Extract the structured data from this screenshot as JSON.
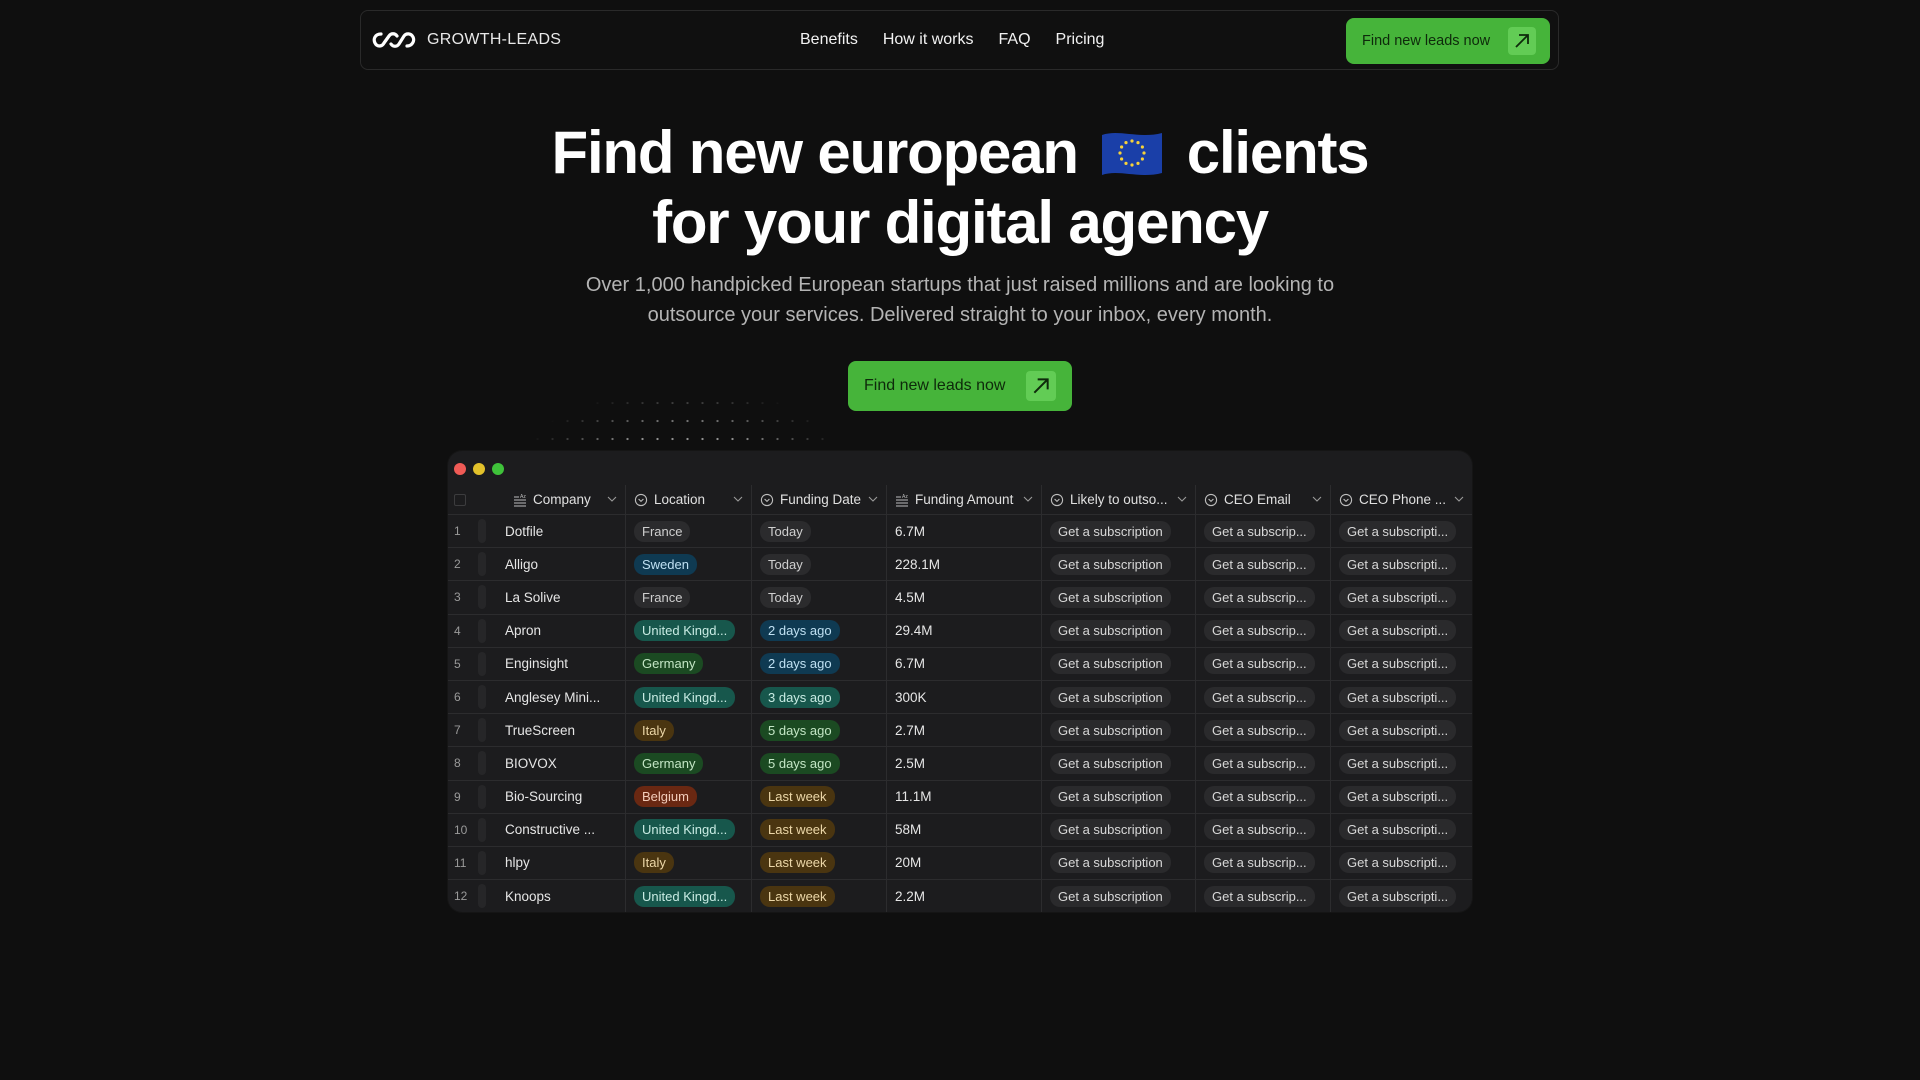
{
  "nav": {
    "brand": "GROWTH-LEADS",
    "links": [
      "Benefits",
      "How it works",
      "FAQ",
      "Pricing"
    ],
    "cta_label": "Find new leads now"
  },
  "hero": {
    "title_line1_before": "Find new european",
    "title_flag": "eu-flag",
    "title_line1_after": "clients",
    "title_line2": "for your digital agency",
    "subtitle_line1": "Over 1,000 handpicked European startups that just raised millions and are looking to",
    "subtitle_line2": "outsource your services. Delivered straight to your inbox, every month.",
    "cta_label": "Find new leads now"
  },
  "colors": {
    "accent": "#46b43a",
    "background": "#0f0f0f",
    "table_bg": "#1c1c1e"
  },
  "table": {
    "columns": [
      {
        "label": "Company",
        "icon": "text-icon"
      },
      {
        "label": "Location",
        "icon": "select-icon"
      },
      {
        "label": "Funding Date",
        "icon": "select-icon"
      },
      {
        "label": "Funding Amount",
        "icon": "text-icon"
      },
      {
        "label": "Likely to outso...",
        "icon": "select-icon"
      },
      {
        "label": "CEO Email",
        "icon": "select-icon"
      },
      {
        "label": "CEO Phone ...",
        "icon": "select-icon"
      }
    ],
    "rows": [
      {
        "n": "1",
        "company": "Dotfile",
        "location": "France",
        "loc_tag": "gray",
        "date": "Today",
        "date_tag": "gray",
        "amount": "6.7M",
        "likely": "Get a subscription",
        "email": "Get a subscrip...",
        "phone": "Get a subscripti..."
      },
      {
        "n": "2",
        "company": "Alligo",
        "location": "Sweden",
        "loc_tag": "blue",
        "date": "Today",
        "date_tag": "gray",
        "amount": "228.1M",
        "likely": "Get a subscription",
        "email": "Get a subscrip...",
        "phone": "Get a subscripti..."
      },
      {
        "n": "3",
        "company": "La Solive",
        "location": "France",
        "loc_tag": "gray",
        "date": "Today",
        "date_tag": "gray",
        "amount": "4.5M",
        "likely": "Get a subscription",
        "email": "Get a subscrip...",
        "phone": "Get a subscripti..."
      },
      {
        "n": "4",
        "company": "Apron",
        "location": "United Kingd...",
        "loc_tag": "teal",
        "date": "2 days ago",
        "date_tag": "blue",
        "amount": "29.4M",
        "likely": "Get a subscription",
        "email": "Get a subscrip...",
        "phone": "Get a subscripti..."
      },
      {
        "n": "5",
        "company": "Enginsight",
        "location": "Germany",
        "loc_tag": "green",
        "date": "2 days ago",
        "date_tag": "blue",
        "amount": "6.7M",
        "likely": "Get a subscription",
        "email": "Get a subscrip...",
        "phone": "Get a subscripti..."
      },
      {
        "n": "6",
        "company": "Anglesey Mini...",
        "location": "United Kingd...",
        "loc_tag": "teal",
        "date": "3 days ago",
        "date_tag": "teal",
        "amount": "300K",
        "likely": "Get a subscription",
        "email": "Get a subscrip...",
        "phone": "Get a subscripti..."
      },
      {
        "n": "7",
        "company": "TrueScreen",
        "location": "Italy",
        "loc_tag": "brown",
        "date": "5 days ago",
        "date_tag": "green",
        "amount": "2.7M",
        "likely": "Get a subscription",
        "email": "Get a subscrip...",
        "phone": "Get a subscripti..."
      },
      {
        "n": "8",
        "company": "BIOVOX",
        "location": "Germany",
        "loc_tag": "green",
        "date": "5 days ago",
        "date_tag": "green",
        "amount": "2.5M",
        "likely": "Get a subscription",
        "email": "Get a subscrip...",
        "phone": "Get a subscripti..."
      },
      {
        "n": "9",
        "company": "Bio-Sourcing",
        "location": "Belgium",
        "loc_tag": "red",
        "date": "Last week",
        "date_tag": "brown",
        "amount": "11.1M",
        "likely": "Get a subscription",
        "email": "Get a subscrip...",
        "phone": "Get a subscripti..."
      },
      {
        "n": "10",
        "company": "Constructive ...",
        "location": "United Kingd...",
        "loc_tag": "teal",
        "date": "Last week",
        "date_tag": "brown",
        "amount": "58M",
        "likely": "Get a subscription",
        "email": "Get a subscrip...",
        "phone": "Get a subscripti..."
      },
      {
        "n": "11",
        "company": "hlpy",
        "location": "Italy",
        "loc_tag": "brown",
        "date": "Last week",
        "date_tag": "brown",
        "amount": "20M",
        "likely": "Get a subscription",
        "email": "Get a subscrip...",
        "phone": "Get a subscripti..."
      },
      {
        "n": "12",
        "company": "Knoops",
        "location": "United Kingd...",
        "loc_tag": "teal",
        "date": "Last week",
        "date_tag": "brown",
        "amount": "2.2M",
        "likely": "Get a subscription",
        "email": "Get a subscrip...",
        "phone": "Get a subscripti..."
      }
    ],
    "tag_colors": {
      "gray": {
        "bg": "#2b2b2d",
        "fg": "#cfcfcf"
      },
      "blue": {
        "bg": "#0f3a52",
        "fg": "#bfe0f2"
      },
      "teal": {
        "bg": "#17574c",
        "fg": "#c8ebe3"
      },
      "green": {
        "bg": "#1b4a22",
        "fg": "#c3e6c5"
      },
      "brown": {
        "bg": "#4a3510",
        "fg": "#ecd7a8"
      },
      "red": {
        "bg": "#6a2812",
        "fg": "#f3cdbb"
      }
    }
  }
}
